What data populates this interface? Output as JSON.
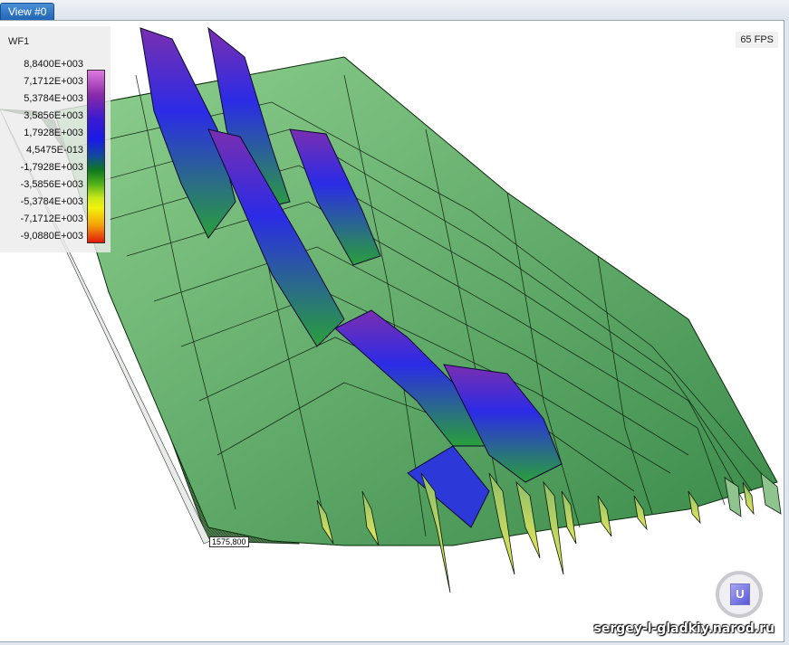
{
  "tab": {
    "label": "View #0"
  },
  "legend": {
    "title": "WF1",
    "labels": [
      "8,8400E+003",
      "7,1712E+003",
      "5,3784E+003",
      "3,5856E+003",
      "1,7928E+003",
      "4,5475E-013",
      "-1,7928E+003",
      "-3,5856E+003",
      "-5,3784E+003",
      "-7,1712E+003",
      "-9,0880E+003"
    ]
  },
  "fps": "65 FPS",
  "coord_label": "1575,800",
  "navcube": {
    "face": "U",
    "icon": "navigation-cube-icon"
  },
  "watermark": "sergey-l-gladkiy.narod.ru",
  "colors": {
    "tab": "#2a6fc0",
    "surface_green": "#6fbf73",
    "surface_blue": "#2a2ae0",
    "surface_purple": "#8a3ab0",
    "base_mesh": "#3f6a3f"
  }
}
